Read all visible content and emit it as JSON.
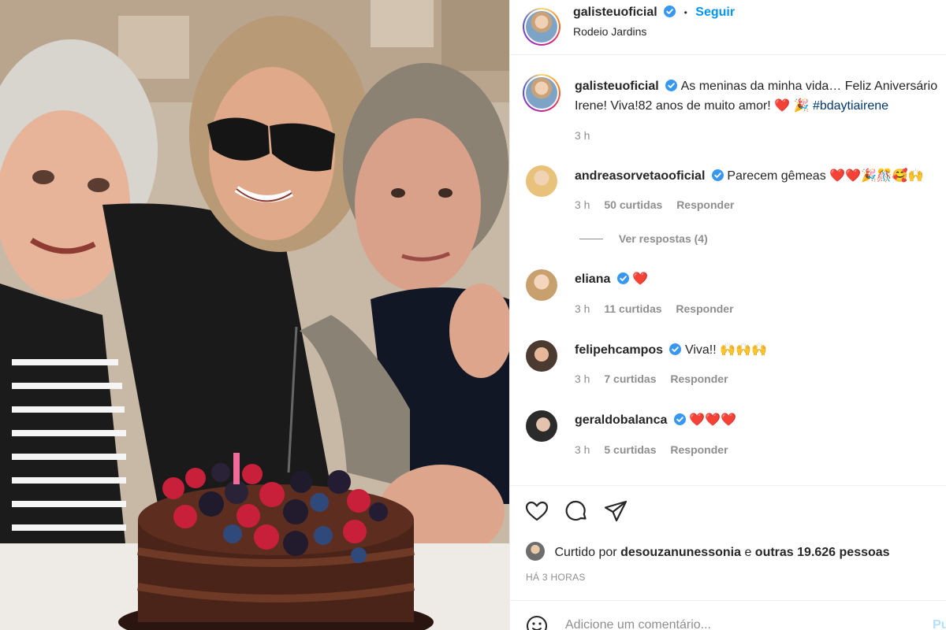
{
  "post": {
    "username": "galisteuoficial",
    "follow_label": "Seguir",
    "separator": "•",
    "location": "Rodeio Jardins",
    "caption_line1": "As meninas da minha vida… Feliz Aniversário",
    "caption_line2": "Irene! Viva!82 anos de muito amor!",
    "caption_emojis": "❤️ 🎉",
    "hashtag": "#bdaytiairene",
    "caption_time": "3 h"
  },
  "comments": [
    {
      "username": "andreasorvetaooficial",
      "text": "Parecem gêmeas",
      "emojis": "❤️❤️🎉🎊🥰🙌",
      "time": "3 h",
      "likes": "50 curtidas",
      "reply": "Responder",
      "replies_label": "Ver respostas (4)"
    },
    {
      "username": "eliana",
      "text": "",
      "emojis": "❤️",
      "time": "3 h",
      "likes": "11 curtidas",
      "reply": "Responder"
    },
    {
      "username": "felipehcampos",
      "text": "Viva!!",
      "emojis": "🙌🙌🙌",
      "time": "3 h",
      "likes": "7 curtidas",
      "reply": "Responder"
    },
    {
      "username": "geraldobalanca",
      "text": "",
      "emojis": "❤️❤️❤️",
      "time": "3 h",
      "likes": "5 curtidas",
      "reply": "Responder"
    }
  ],
  "likes": {
    "prefix": "Curtido por",
    "user": "desouzanunessonia",
    "middle": "e",
    "others": "outras 19.626 pessoas"
  },
  "timestamp": "HÁ 3 HORAS",
  "comment_box": {
    "placeholder": "Adicione um comentário...",
    "publish_label": "Pu"
  },
  "colors": {
    "link_blue": "#0095f6",
    "verified_blue": "#3897f0",
    "heart_red": "#ed4956",
    "muted": "#8e8e8e"
  },
  "icons": [
    "heart-icon",
    "comment-icon",
    "share-icon",
    "emoji-icon",
    "verified-icon"
  ]
}
